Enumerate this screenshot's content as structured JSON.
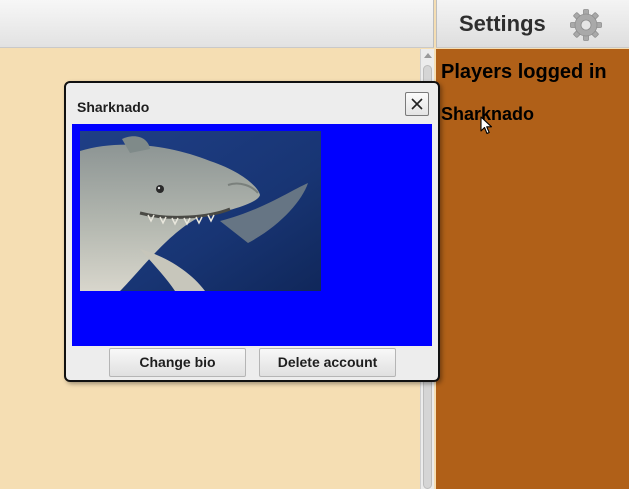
{
  "header": {
    "settings_label": "Settings",
    "settings_icon": "gear-icon"
  },
  "players_panel": {
    "title": "Players logged in",
    "players": [
      "Sharknado"
    ],
    "background": "#b06018"
  },
  "dialog": {
    "title": "Sharknado",
    "close_icon": "close-icon",
    "image": "shark photo",
    "bio_background": "#0000ff",
    "buttons": {
      "change_bio": "Change bio",
      "delete_account": "Delete account"
    }
  },
  "colors": {
    "page_background": "#f5deb3",
    "panel": "#b06018",
    "bio_area": "#0000ff"
  }
}
